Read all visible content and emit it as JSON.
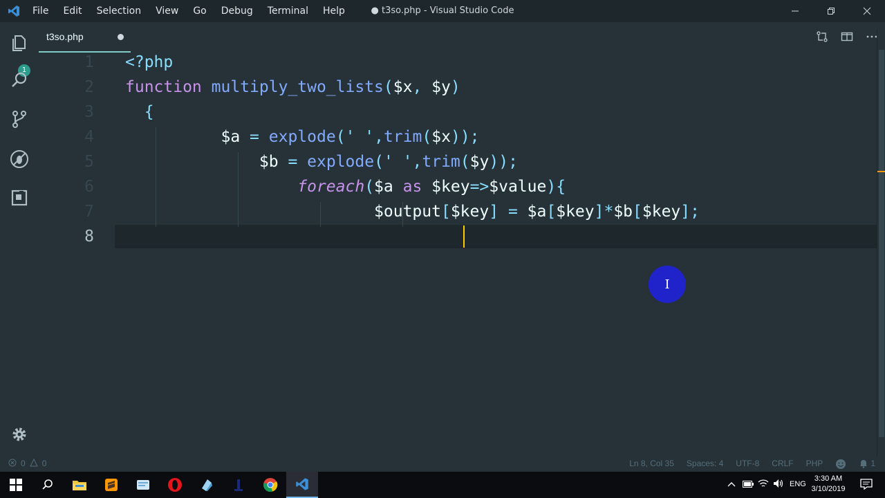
{
  "titlebar": {
    "menu": [
      "File",
      "Edit",
      "Selection",
      "View",
      "Go",
      "Debug",
      "Terminal",
      "Help"
    ],
    "title": "● t3so.php - Visual Studio Code"
  },
  "activity_bar": {
    "items": [
      "explorer-icon",
      "search-icon",
      "source-control-icon",
      "debug-icon",
      "extensions-icon"
    ],
    "explorer_badge": "1",
    "settings": "gear-icon"
  },
  "tab": {
    "filename": "t3so.php",
    "dirty": true
  },
  "editor": {
    "line_numbers": [
      "1",
      "2",
      "3",
      "4",
      "5",
      "6",
      "7",
      "8"
    ],
    "current_line": 8,
    "lines": [
      "<?php",
      "function multiply_two_lists($x, $y)",
      "  {",
      "          $a = explode(' ',trim($x));",
      "              $b = explode(' ',trim($y));",
      "                  foreach($a as $key=>$value){",
      "                          $output[$key] = $a[$key]*$b[$key];",
      ""
    ]
  },
  "statusbar": {
    "errors": "0",
    "warnings": "0",
    "position": "Ln 8, Col 35",
    "spaces": "Spaces: 4",
    "encoding": "UTF-8",
    "eol": "CRLF",
    "language": "PHP",
    "notifications": "1"
  },
  "taskbar": {
    "apps": [
      "windows-start",
      "search",
      "file-explorer",
      "sublime-text",
      "notepad",
      "opera",
      "app",
      "app",
      "chrome",
      "vscode"
    ],
    "language": "ENG",
    "time": "3:30 AM",
    "date": "3/10/2019"
  },
  "mouse_cursor_icon": "I"
}
